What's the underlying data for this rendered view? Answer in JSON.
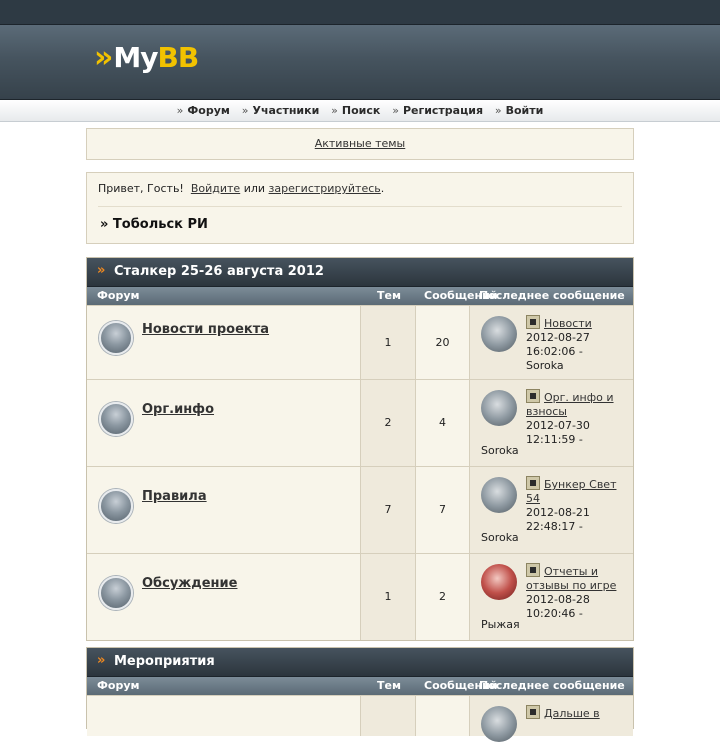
{
  "logo": {
    "my": "My",
    "bb": "BB",
    "arrows": "»"
  },
  "nav": {
    "items": [
      "Форум",
      "Участники",
      "Поиск",
      "Регистрация",
      "Войти"
    ]
  },
  "active_topics": "Активные темы",
  "welcome": {
    "greeting": "Привет, Гость!",
    "login_link": "Войдите",
    "or": "или",
    "register_link": "зарегистрируйтесь",
    "end": ".",
    "crumb": "» Тобольск РИ"
  },
  "columns": {
    "forum": "Форум",
    "topics": "Тем",
    "posts": "Сообщений",
    "last": "Последнее сообщение"
  },
  "categories": [
    {
      "title": "Сталкер 25-26 августа 2012",
      "forums": [
        {
          "name": "Новости проекта",
          "topics": "1",
          "posts": "20",
          "last_title": "Новости",
          "last_date": "2012-08-27",
          "last_time": "16:02:06 -",
          "last_author": "Soroka"
        },
        {
          "name": "Орг.инфо",
          "topics": "2",
          "posts": "4",
          "last_title_1": "Орг. инфо и",
          "last_title_2": "взносы",
          "last_date": "2012-07-30",
          "last_time": "12:11:59 -",
          "last_author": "Soroka"
        },
        {
          "name": "Правила",
          "topics": "7",
          "posts": "7",
          "last_title_1": "Бункер Свет",
          "last_title_2": "54",
          "last_date": "2012-08-21",
          "last_time": "22:48:17 -",
          "last_author": "Soroka"
        },
        {
          "name": "Обсуждение",
          "topics": "1",
          "posts": "2",
          "last_title_1": "Отчеты и",
          "last_title_2": "отзывы по игре",
          "last_date": "2012-08-28",
          "last_time": "10:20:46 -",
          "last_author": "Рыжая"
        }
      ]
    },
    {
      "title": "Мероприятия",
      "forums": [
        {
          "last_title_1": "Дальше в"
        }
      ]
    }
  ],
  "colors": {
    "accent": "#f0891f",
    "header": "#36424b",
    "row_bg": "#f8f5ea"
  }
}
